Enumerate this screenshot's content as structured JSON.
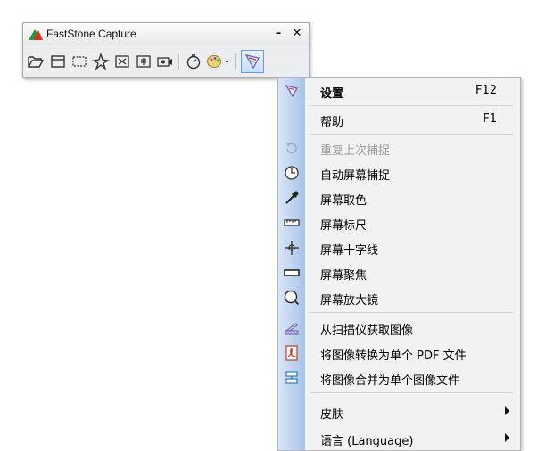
{
  "window": {
    "title": "FastStone Capture",
    "minimize_label": "–",
    "close_label": "✕"
  },
  "toolbar": {
    "tools": [
      {
        "name": "open-file",
        "icon": "folder-open-icon"
      },
      {
        "name": "capture-active-window",
        "icon": "window-icon"
      },
      {
        "name": "capture-rectangle",
        "icon": "rectangle-icon"
      },
      {
        "name": "capture-freehand",
        "icon": "freehand-icon"
      },
      {
        "name": "capture-fullscreen",
        "icon": "fullscreen-icon"
      },
      {
        "name": "capture-scrolling",
        "icon": "scrolling-window-icon"
      },
      {
        "name": "screen-recorder",
        "icon": "video-icon"
      },
      {
        "name": "delay-timer",
        "icon": "timer-icon"
      },
      {
        "name": "output-destination",
        "icon": "palette-icon"
      },
      {
        "name": "settings",
        "icon": "settings-icon"
      }
    ]
  },
  "menu": {
    "items": [
      {
        "label": "设置",
        "shortcut": "F12",
        "icon": "settings-icon",
        "bold": true
      },
      {
        "label": "帮助",
        "shortcut": "F1"
      },
      {
        "label": "重复上次捕捉",
        "icon": "repeat-icon",
        "disabled": true
      },
      {
        "label": "自动屏幕捕捉",
        "icon": "clock-icon"
      },
      {
        "label": "屏幕取色",
        "icon": "eyedropper-icon"
      },
      {
        "label": "屏幕标尺",
        "icon": "ruler-icon"
      },
      {
        "label": "屏幕十字线",
        "icon": "crosshair-icon"
      },
      {
        "label": "屏幕聚焦",
        "icon": "focus-bar-icon"
      },
      {
        "label": "屏幕放大镜",
        "icon": "magnifier-icon"
      },
      {
        "label": "从扫描仪获取图像",
        "icon": "scanner-icon"
      },
      {
        "label": "将图像转换为单个 PDF 文件",
        "icon": "pdf-icon"
      },
      {
        "label": "将图像合并为单个图像文件",
        "icon": "combine-images-icon"
      },
      {
        "label": "皮肤",
        "submenu": true
      },
      {
        "label": "语言 (Language)",
        "submenu": true
      }
    ]
  },
  "colors": {
    "menu_bg": "#f2f2f2",
    "gutter_start": "#d9e6f6",
    "gutter_end": "#a9c3ea",
    "disabled_text": "#9a9a9a",
    "logo_red": "#e0301e",
    "logo_green": "#1e9a3c"
  }
}
